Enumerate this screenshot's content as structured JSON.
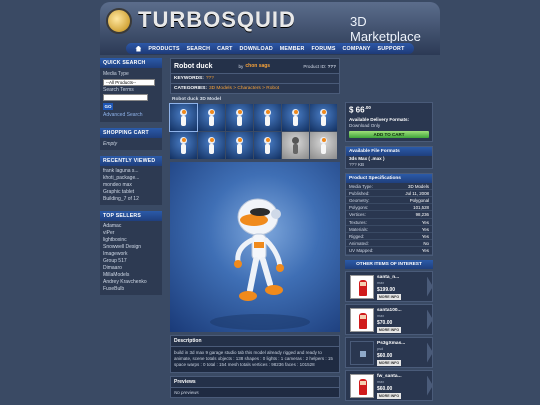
{
  "header": {
    "logo_text": "TURBOSQUID",
    "tagline": "3D Marketplace",
    "nav": [
      "PRODUCTS",
      "SEARCH",
      "CART",
      "DOWNLOAD",
      "MEMBER",
      "FORUMS",
      "COMPANY",
      "SUPPORT"
    ]
  },
  "sidebar": {
    "quick_search": {
      "title": "QUICK SEARCH",
      "media_type_label": "Media Type",
      "media_type_value": "--All Products--",
      "search_terms_label": "Search Terms",
      "search_terms_value": "",
      "go_label": "GO",
      "advanced_link": "Advanced Search"
    },
    "shopping_cart": {
      "title": "SHOPPING CART",
      "status": "Empty"
    },
    "recently_viewed": {
      "title": "RECENTLY VIEWED",
      "items": [
        "frank laguna s...",
        "khoti_package...",
        "mondeo max",
        "Graphic tablet",
        "Building_7 of 12"
      ]
    },
    "top_sellers": {
      "title": "TOP SELLERS",
      "items": [
        "Adamac",
        "viPer",
        "lightboxinc",
        "Snowwell Design",
        "Imagework",
        "Group 517",
        "Dimaaro",
        "MillaModels",
        "Andrey Kravchenko",
        "FuseBulb"
      ]
    }
  },
  "product": {
    "title": "Robot duck",
    "by_label": "by",
    "author": "chon sags",
    "product_id_label": "Product ID:",
    "product_id": "???",
    "keywords_label": "KEYWORDS:",
    "keywords": "???",
    "categories_label": "CATEGORIES:",
    "categories": "3D Models > Characters > Robot",
    "model_label": "Robot duck 3D Model",
    "description_title": "Description",
    "description": "build in 3d max 9 garage studio tab this model already rigged and ready to animate, scene totals objects : 138 shapes : 0 lights : 1 cameras : 2 helpers : 15 space warps : 0 total : 154 mesh totals vertices : 98236 faces : 101528",
    "previews_title": "Previews",
    "previews_text": "No previews"
  },
  "purchase": {
    "price": "$ 66",
    "price_cents": ".00",
    "delivery_label": "Available Delivery Formats:",
    "delivery_value": "Download Only",
    "add_to_cart": "ADD TO CART"
  },
  "file_formats": {
    "title": "Available File Formats",
    "format": "3ds Max ( .max )",
    "size": "??? KB"
  },
  "specs": {
    "title": "Product Specifications",
    "rows": [
      {
        "label": "Media Type:",
        "value": "3D Models"
      },
      {
        "label": "Published:",
        "value": "Jul 11, 2008"
      },
      {
        "label": "Geometry:",
        "value": "Polygonal"
      },
      {
        "label": "Polygons:",
        "value": "101,528"
      },
      {
        "label": "Vertices:",
        "value": "98,236"
      },
      {
        "label": "Textures:",
        "value": "Yes"
      },
      {
        "label": "Materials:",
        "value": "Yes"
      },
      {
        "label": "Rigged:",
        "value": "Yes"
      },
      {
        "label": "Animated:",
        "value": "No"
      },
      {
        "label": "UV Mapped:",
        "value": "Yes"
      }
    ]
  },
  "other_items": {
    "title": "OTHER ITEMS OF INTEREST",
    "more_label": "MORE INFO",
    "items": [
      {
        "name": "santa_n...",
        "format": "max",
        "price": "$199.00"
      },
      {
        "name": "santa100...",
        "format": "max",
        "price": "$70.00"
      },
      {
        "name": "Ps3gXmas...",
        "format": "psd",
        "price": "$60.00"
      },
      {
        "name": "fw_santa...",
        "format": "max",
        "price": "$60.00"
      }
    ]
  }
}
